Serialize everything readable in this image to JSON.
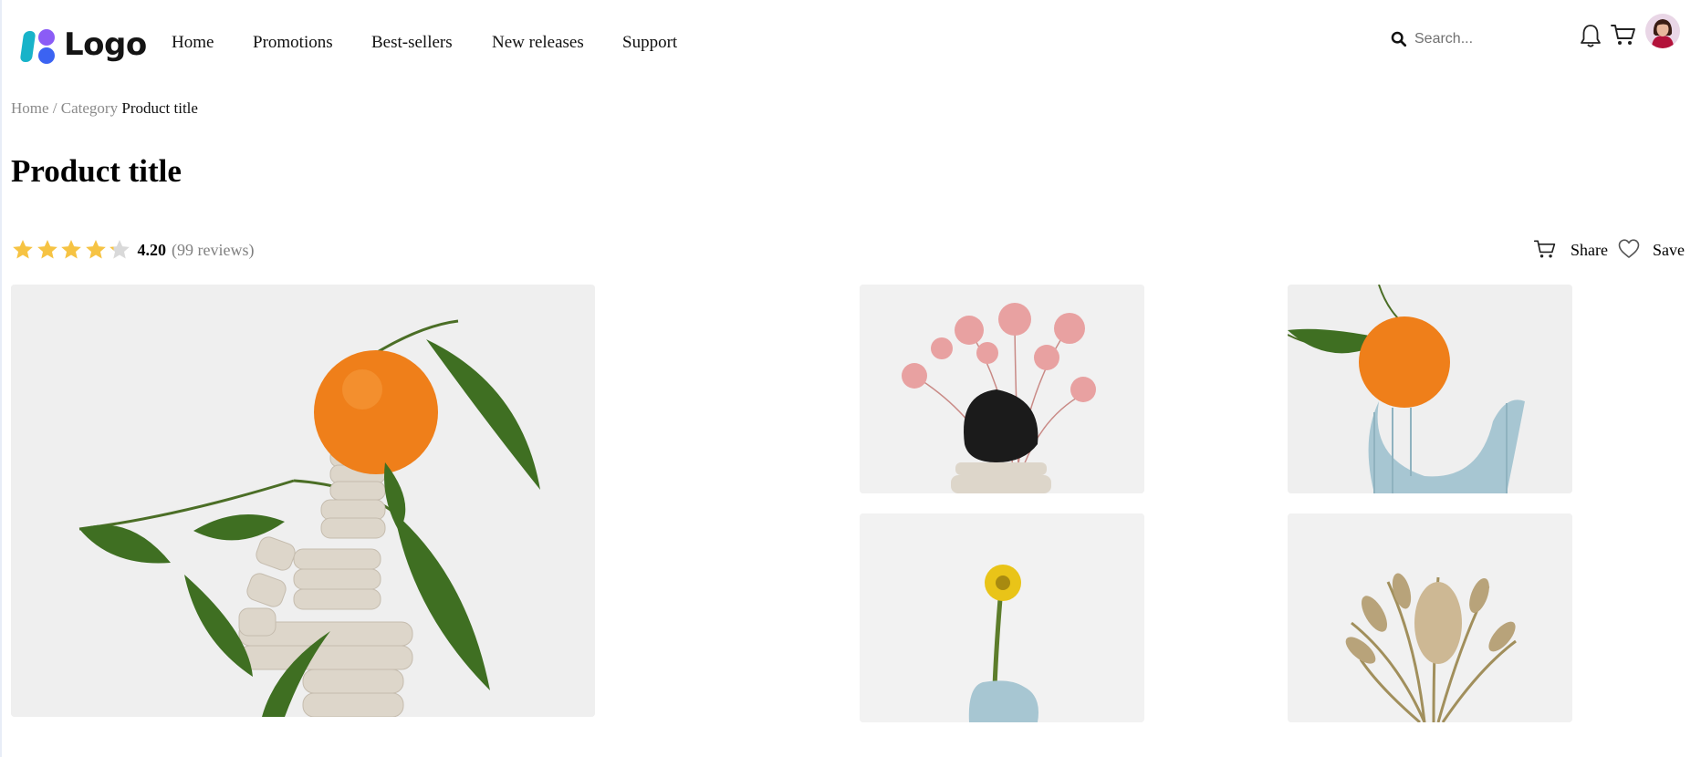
{
  "brand": {
    "logo_text": "Logo"
  },
  "nav": {
    "items": [
      {
        "label": "Home"
      },
      {
        "label": "Promotions"
      },
      {
        "label": "Best-sellers"
      },
      {
        "label": "New releases"
      },
      {
        "label": "Support"
      }
    ]
  },
  "search": {
    "placeholder": "Search..."
  },
  "header_icons": {
    "notifications": "bell-icon",
    "cart": "cart-icon",
    "profile": "avatar"
  },
  "breadcrumb": {
    "home": "Home",
    "separator": "/",
    "category": "Category",
    "current": "Product title"
  },
  "product": {
    "title": "Product title",
    "rating_value": "4.20",
    "rating_reviews": "(99 reviews)",
    "rating_numeric": 4.2,
    "rating_max": 5
  },
  "actions": {
    "share_label": "Share",
    "save_label": "Save"
  },
  "gallery": {
    "images": [
      {
        "subject": "orange on stacked clay sculpture with leaves"
      },
      {
        "subject": "pink dried flowers with black stone"
      },
      {
        "subject": "orange on blue clay arch"
      },
      {
        "subject": "yellow flower in blue clay vase"
      },
      {
        "subject": "dried banksia bouquet"
      }
    ]
  },
  "colors": {
    "star": "#f6c343",
    "star_empty": "#d9d9d9",
    "logo_cyan": "#18b3c9",
    "logo_purple": "#8b5cf6",
    "logo_blue": "#3b63f2",
    "muted_text": "#8a8a8a",
    "photo_bg": "#f1f1f1"
  }
}
